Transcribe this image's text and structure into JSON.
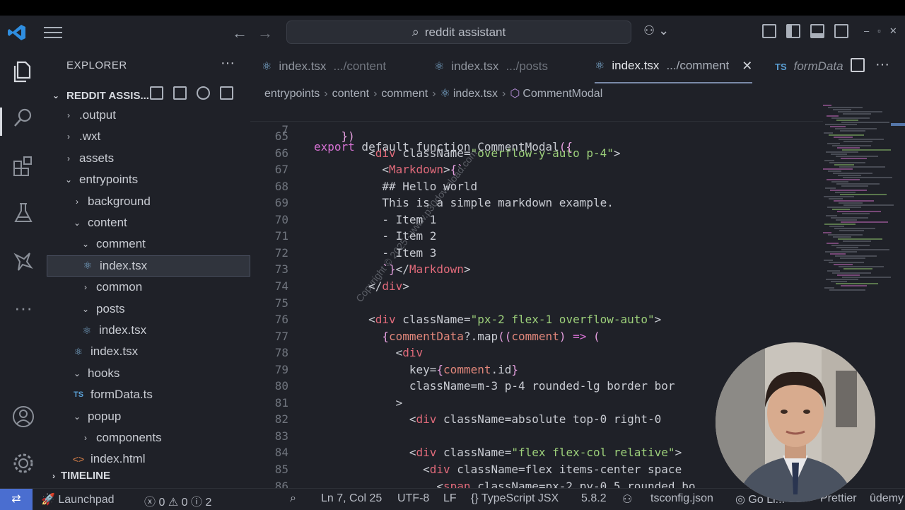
{
  "titlebar": {
    "search_text": "reddit assistant"
  },
  "sidebar": {
    "title": "EXPLORER",
    "project": "REDDIT ASSIS...",
    "tree": [
      {
        "label": ".output",
        "kind": "folder",
        "open": false
      },
      {
        "label": ".wxt",
        "kind": "folder",
        "open": false
      },
      {
        "label": "assets",
        "kind": "folder",
        "open": false
      },
      {
        "label": "entrypoints",
        "kind": "folder",
        "open": true
      },
      {
        "label": "background",
        "kind": "folder",
        "open": false
      },
      {
        "label": "content",
        "kind": "folder",
        "open": true
      },
      {
        "label": "comment",
        "kind": "folder",
        "open": true
      },
      {
        "label": "index.tsx",
        "kind": "react",
        "selected": true
      },
      {
        "label": "common",
        "kind": "folder",
        "open": false
      },
      {
        "label": "posts",
        "kind": "folder",
        "open": true
      },
      {
        "label": "index.tsx",
        "kind": "react"
      },
      {
        "label": "index.tsx",
        "kind": "react"
      },
      {
        "label": "hooks",
        "kind": "folder",
        "open": true
      },
      {
        "label": "formData.ts",
        "kind": "ts"
      },
      {
        "label": "popup",
        "kind": "folder",
        "open": true
      },
      {
        "label": "components",
        "kind": "folder",
        "open": false
      },
      {
        "label": "index.html",
        "kind": "html"
      }
    ],
    "timeline": "TIMELINE"
  },
  "tabs": [
    {
      "name": "index.tsx",
      "desc": ".../content"
    },
    {
      "name": "index.tsx",
      "desc": ".../posts"
    },
    {
      "name": "index.tsx",
      "desc": ".../comment"
    },
    {
      "name": "formData",
      "desc": ""
    }
  ],
  "tab_ts_prefix": "TS",
  "breadcrumb": [
    "entrypoints",
    "content",
    "comment",
    "index.tsx",
    "CommentModal"
  ],
  "code": {
    "sticky": {
      "ln": "7",
      "text": "export default function CommentModal({"
    },
    "lines": [
      {
        "ln": "65",
        "text": "    })"
      },
      {
        "ln": "66",
        "text": "        <div className=\"overflow-y-auto p-4\">"
      },
      {
        "ln": "67",
        "text": "          <Markdown>{`"
      },
      {
        "ln": "68",
        "text": "          ## Hello world"
      },
      {
        "ln": "69",
        "text": "          This is a simple markdown example."
      },
      {
        "ln": "70",
        "text": "          - Item 1"
      },
      {
        "ln": "71",
        "text": "          - Item 2"
      },
      {
        "ln": "72",
        "text": "          - Item 3"
      },
      {
        "ln": "73",
        "text": "          `}</Markdown>"
      },
      {
        "ln": "74",
        "text": "        </div>"
      },
      {
        "ln": "75",
        "text": ""
      },
      {
        "ln": "76",
        "text": "        <div className=\"px-2 flex-1 overflow-auto\">"
      },
      {
        "ln": "77",
        "text": "          {commentData?.map((comment) => ("
      },
      {
        "ln": "78",
        "text": "            <div"
      },
      {
        "ln": "79",
        "text": "              key={comment.id}"
      },
      {
        "ln": "80",
        "text": "              className=\"m-3 p-4 rounded-lg border bor"
      },
      {
        "ln": "81",
        "text": "            >"
      },
      {
        "ln": "82",
        "text": "              <div className=\"absolute top-0 right-0"
      },
      {
        "ln": "83",
        "text": ""
      },
      {
        "ln": "84",
        "text": "              <div className=\"flex flex-col relative\">"
      },
      {
        "ln": "85",
        "text": "                <div className=\"flex items-center space"
      },
      {
        "ln": "86",
        "text": "                  <span className=\"px-2 py-0.5 rounded bo"
      }
    ]
  },
  "watermark": "Copyright © 2025 - www.p30download.com",
  "statusbar": {
    "launchpad": "Launchpad",
    "errors": "0",
    "warnings": "0",
    "info": "2",
    "position": "Ln 7, Col 25",
    "encoding": "UTF-8",
    "eol": "LF",
    "language": "TypeScript JSX",
    "version": "5.8.2",
    "tsconfig": "tsconfig.json",
    "golive": "Go Li...",
    "prettier": "Prettier",
    "udemy": "ûdemy"
  },
  "colors": {
    "background": "#1f2128",
    "remote_accent": "#4a6ed0",
    "keyword": "#d772d4",
    "function": "#7fb9e6",
    "tag": "#e06a7a",
    "attribute": "#e6b86a",
    "string": "#9ccf7a"
  }
}
